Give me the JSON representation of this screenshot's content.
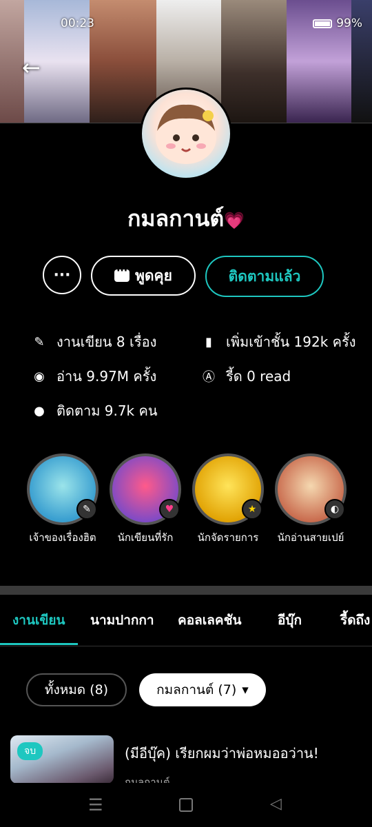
{
  "status_bar": {
    "time": "00:23",
    "battery": "99%"
  },
  "profile": {
    "name": "กมลกานต์",
    "heart_badge": "💗"
  },
  "actions": {
    "more_label": "···",
    "chat_label": "พูดคุย",
    "follow_label": "ติดตามแล้ว"
  },
  "stats": {
    "works": "งานเขียน 8 เรื่อง",
    "shelved": "เพิ่มเข้าชั้น 192k ครั้ง",
    "reads": "อ่าน 9.97M ครั้ง",
    "reader": "รี้ด 0 read",
    "followers": "ติดตาม 9.7k คน"
  },
  "badges": [
    {
      "label": "เจ้าของเรื่องฮิต",
      "icon": "feather-icon"
    },
    {
      "label": "นักเขียนที่รัก",
      "icon": "hearts-icon"
    },
    {
      "label": "นักจัดรายการ",
      "icon": "stars-icon"
    },
    {
      "label": "นักอ่านสายเปย์",
      "icon": "bubble-tea-icon"
    }
  ],
  "tabs": [
    "งานเขียน",
    "นามปากกา",
    "คอลเลคชัน",
    "อีบุ๊ก",
    "รี้ดถึง"
  ],
  "filters": {
    "all": "ทั้งหมด (8)",
    "penname": "กมลกานต์ (7)"
  },
  "story": {
    "status": "จบ",
    "title": "(มีอีบุ๊ค) เรียกผมว่าพ่อหมออว่าน!",
    "author": "กมลกานต์"
  },
  "colors": {
    "accent": "#1ec7c0",
    "background": "#000000"
  }
}
